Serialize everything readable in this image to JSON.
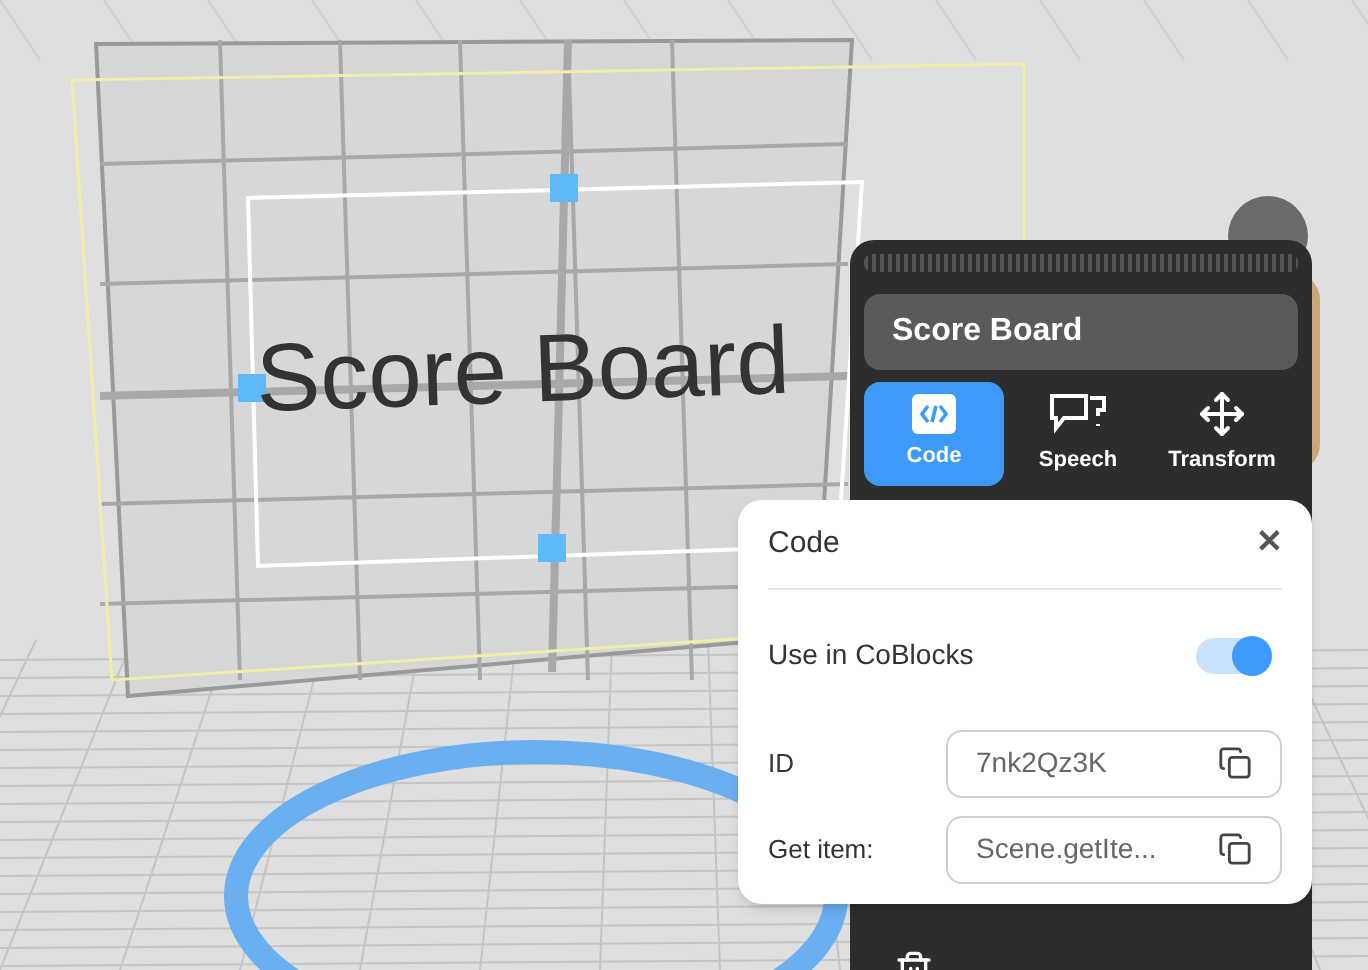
{
  "scene": {
    "board_text": "Score Board"
  },
  "panel": {
    "object_name": "Score Board",
    "tabs": [
      {
        "label": "Code",
        "kind": "code",
        "selected": true
      },
      {
        "label": "Speech",
        "kind": "speech",
        "selected": false
      },
      {
        "label": "Transform",
        "kind": "transform",
        "selected": false
      }
    ]
  },
  "code_popup": {
    "title": "Code",
    "close": "✕",
    "use_in_coblocks": {
      "label": "Use in CoBlocks",
      "on": true
    },
    "fields": [
      {
        "label": "ID",
        "value": "7nk2Qz3K"
      },
      {
        "label": "Get item:",
        "value": "Scene.getIte..."
      }
    ]
  }
}
